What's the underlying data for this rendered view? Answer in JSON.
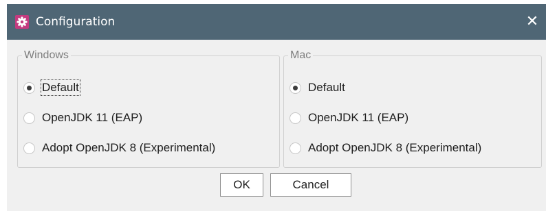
{
  "window": {
    "title": "Configuration",
    "app_icon": "gear-icon",
    "close_symbol": "✕",
    "titlebar_color": "#4f6675",
    "app_icon_color": "#c43b7f"
  },
  "groups": [
    {
      "legend": "Windows",
      "options": [
        {
          "label": "Default",
          "selected": true
        },
        {
          "label": "OpenJDK 11 (EAP)",
          "selected": false
        },
        {
          "label": "Adopt OpenJDK 8 (Experimental)",
          "selected": false
        }
      ]
    },
    {
      "legend": "Mac",
      "options": [
        {
          "label": "Default",
          "selected": true
        },
        {
          "label": "OpenJDK 11 (EAP)",
          "selected": false
        },
        {
          "label": "Adopt OpenJDK 8 (Experimental)",
          "selected": false
        }
      ]
    }
  ],
  "buttons": {
    "ok": "OK",
    "cancel": "Cancel"
  }
}
